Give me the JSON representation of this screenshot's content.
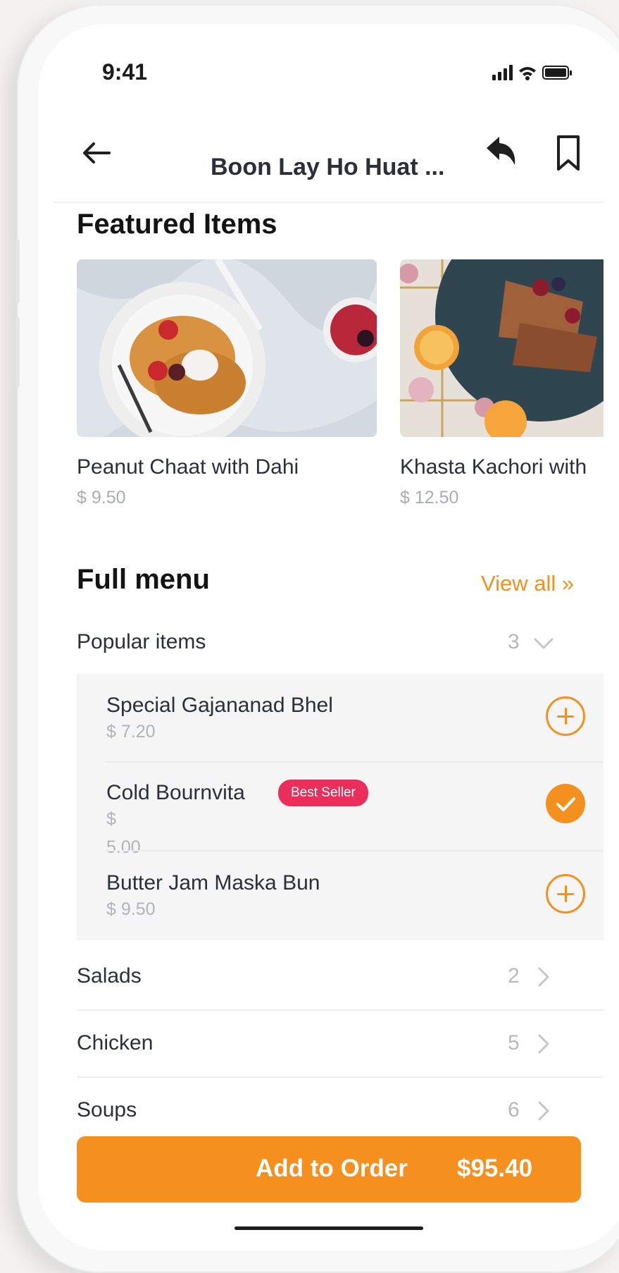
{
  "status_bar": {
    "time": "9:41"
  },
  "nav": {
    "title": "Boon Lay Ho Huat ..."
  },
  "featured": {
    "title": "Featured Items",
    "items": [
      {
        "name": "Peanut Chaat with Dahi",
        "price": "$ 9.50"
      },
      {
        "name": "Khasta Kachori with",
        "price": "$ 12.50"
      }
    ]
  },
  "menu": {
    "title": "Full menu",
    "view_all": "View all »",
    "categories": [
      {
        "label": "Popular items",
        "count": "3",
        "expanded": true,
        "items": [
          {
            "name": "Special Gajananad Bhel",
            "price": "$ 7.20",
            "state": "add"
          },
          {
            "name": "Cold Bournvita",
            "price_line1": "$",
            "price_line2": "5.00",
            "badge": "Best Seller",
            "state": "added"
          },
          {
            "name": "Butter Jam Maska Bun",
            "price": "$ 9.50",
            "state": "add"
          }
        ]
      },
      {
        "label": "Salads",
        "count": "2",
        "expanded": false
      },
      {
        "label": "Chicken",
        "count": "5",
        "expanded": false
      },
      {
        "label": "Soups",
        "count": "6",
        "expanded": false
      }
    ]
  },
  "order_button": {
    "label": "Add to Order",
    "total": "$95.40"
  },
  "colors": {
    "accent": "#f4911e",
    "badge": "#ea2f5d",
    "text": "#2a2f3a",
    "muted": "#b0b3b8"
  },
  "icons": [
    "back-arrow-icon",
    "share-icon",
    "bookmark-icon",
    "signal-icon",
    "wifi-icon",
    "battery-icon",
    "chevron-down-icon",
    "chevron-right-icon",
    "plus-circle-icon",
    "check-circle-icon"
  ]
}
